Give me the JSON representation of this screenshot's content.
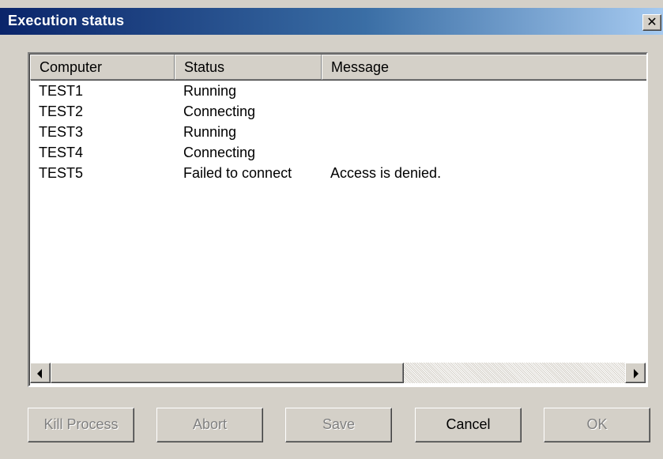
{
  "window": {
    "title": "Execution status",
    "close_glyph": "✕"
  },
  "list": {
    "columns": [
      "Computer",
      "Status",
      "Message"
    ],
    "rows": [
      {
        "computer": "TEST1",
        "status": "Running",
        "message": ""
      },
      {
        "computer": "TEST2",
        "status": "Connecting",
        "message": ""
      },
      {
        "computer": "TEST3",
        "status": "Running",
        "message": ""
      },
      {
        "computer": "TEST4",
        "status": "Connecting",
        "message": ""
      },
      {
        "computer": "TEST5",
        "status": "Failed to connect",
        "message": "Access is denied."
      }
    ]
  },
  "buttons": {
    "kill_process": "Kill Process",
    "abort": "Abort",
    "save": "Save",
    "cancel": "Cancel",
    "ok": "OK"
  },
  "colors": {
    "title_gradient_start": "#0a246a",
    "title_gradient_end": "#a6caf0",
    "face": "#d4d0c8",
    "disabled_text": "#808080"
  }
}
